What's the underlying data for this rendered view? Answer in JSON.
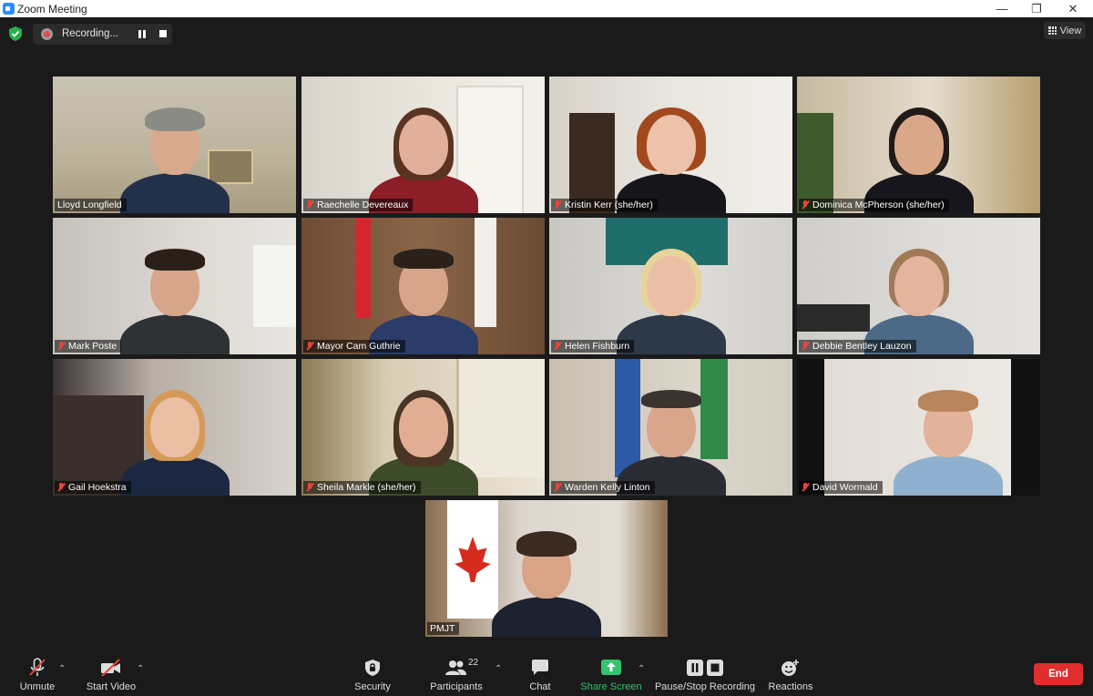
{
  "window": {
    "title": "Zoom Meeting"
  },
  "recording": {
    "status": "Recording..."
  },
  "view_button": {
    "label": "View"
  },
  "participants": [
    {
      "name": "Lloyd Longfield",
      "muted": false,
      "active": true
    },
    {
      "name": "Raechelle Devereaux",
      "muted": true
    },
    {
      "name": "Kristin Kerr (she/her)",
      "muted": true
    },
    {
      "name": "Dominica McPherson (she/her)",
      "muted": true
    },
    {
      "name": "Mark Poste",
      "muted": true
    },
    {
      "name": "Mayor Cam Guthrie",
      "muted": true
    },
    {
      "name": "Helen Fishburn",
      "muted": true
    },
    {
      "name": "Debbie Bentley Lauzon",
      "muted": true
    },
    {
      "name": "Gail Hoekstra",
      "muted": true
    },
    {
      "name": "Sheila Markle (she/her)",
      "muted": true
    },
    {
      "name": "Warden Kelly Linton",
      "muted": true
    },
    {
      "name": "David Wormald",
      "muted": true
    },
    {
      "name": "PMJT",
      "muted": false
    }
  ],
  "toolbar": {
    "unmute": "Unmute",
    "start_video": "Start Video",
    "security": "Security",
    "participants": "Participants",
    "participant_count": "22",
    "chat": "Chat",
    "share_screen": "Share Screen",
    "pause_stop_recording": "Pause/Stop Recording",
    "reactions": "Reactions",
    "end": "End"
  },
  "colors": {
    "active_speaker_border": "#c9e04a",
    "share_green": "#35c36b",
    "end_red": "#e02e2e",
    "mute_red": "#e8453c"
  }
}
